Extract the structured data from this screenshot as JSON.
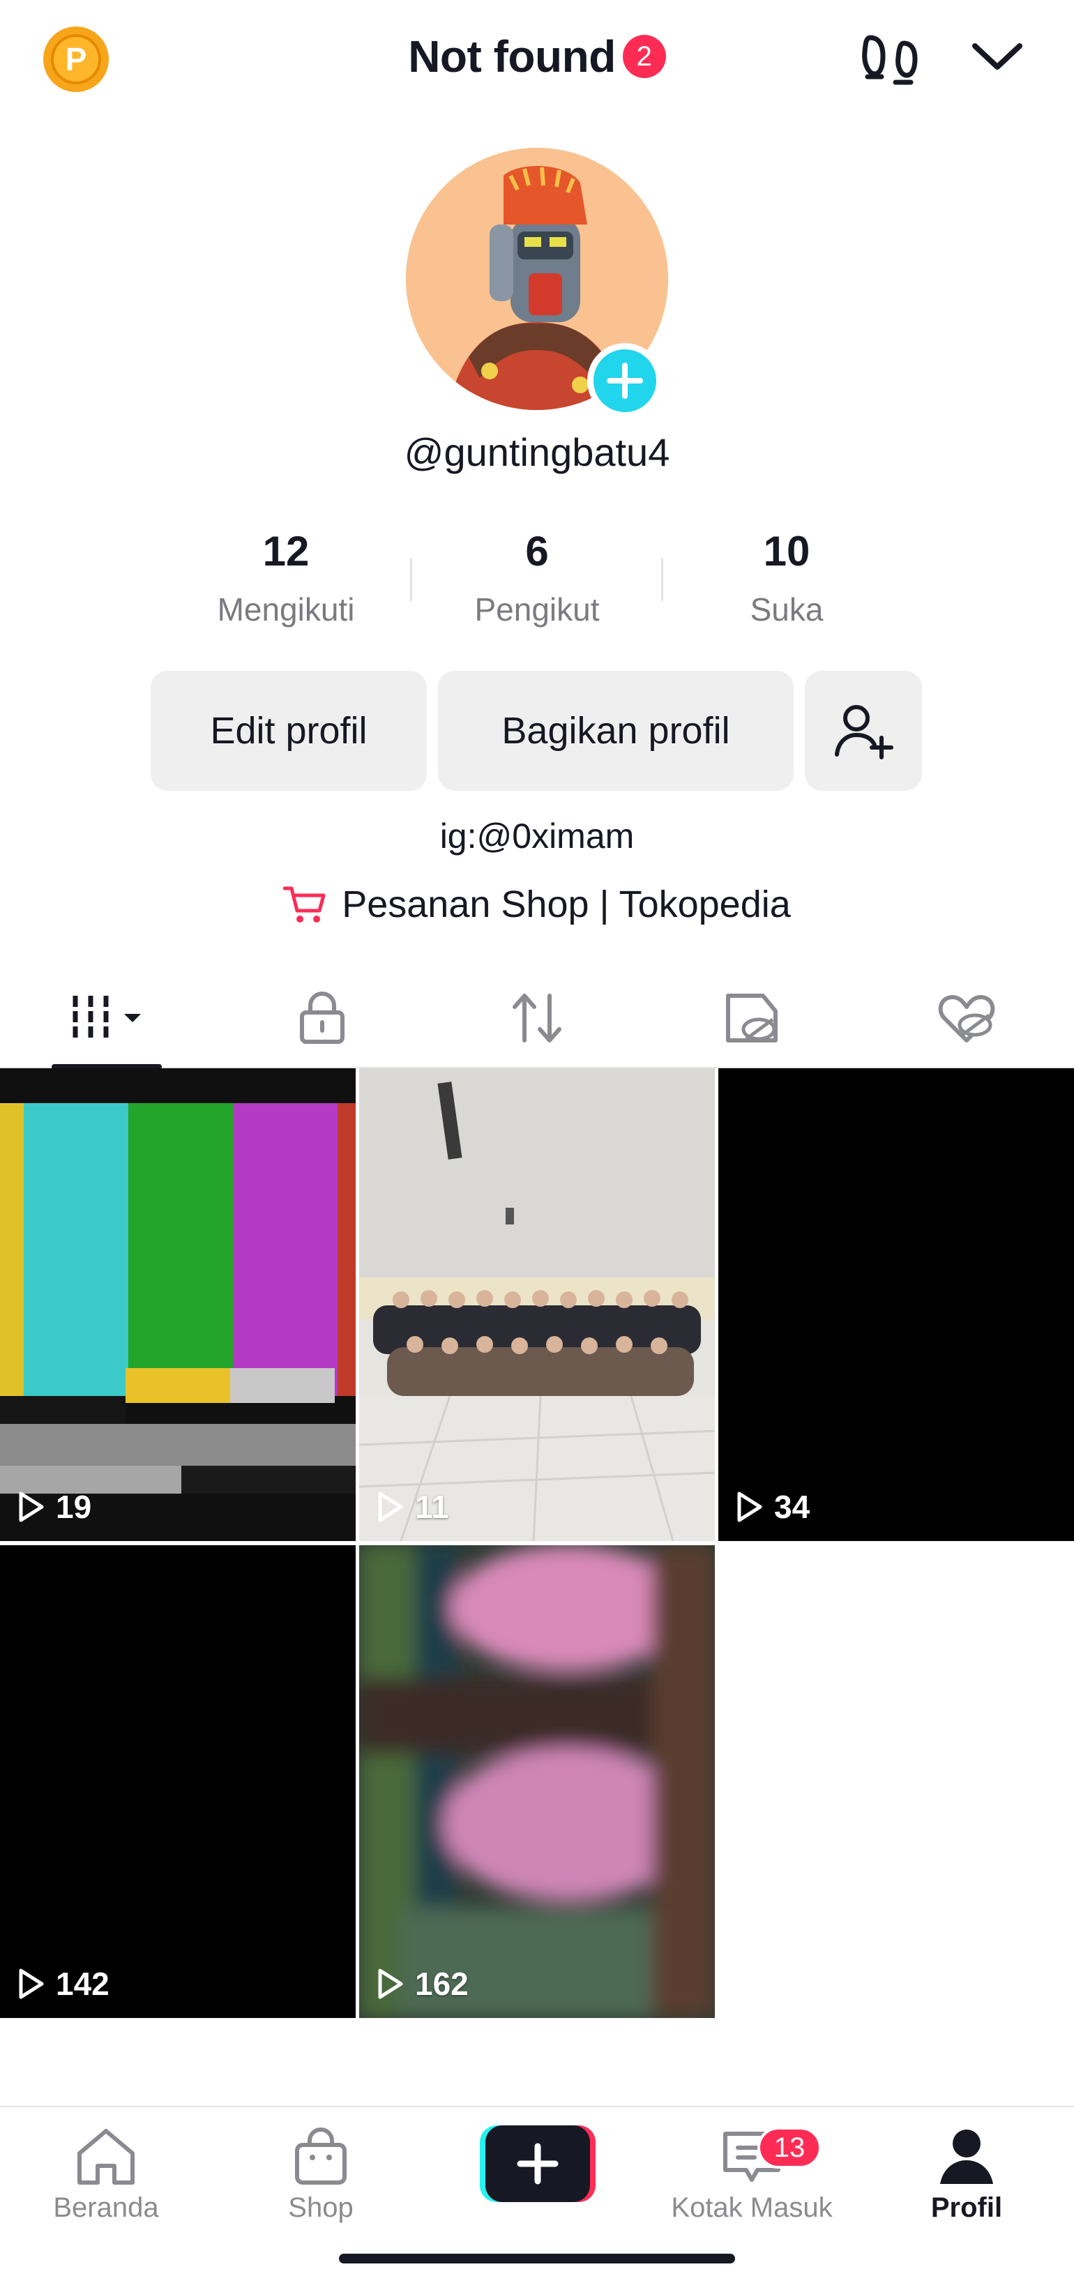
{
  "header": {
    "coin_letter": "P",
    "title": "Not found",
    "notification_count": "2"
  },
  "profile": {
    "username": "@guntingbatu4",
    "stats": [
      {
        "value": "12",
        "label": "Mengikuti"
      },
      {
        "value": "6",
        "label": "Pengikut"
      },
      {
        "value": "10",
        "label": "Suka"
      }
    ],
    "edit_label": "Edit profil",
    "share_label": "Bagikan profil",
    "bio": "ig:@0ximam",
    "shop_link": "Pesanan Shop | Tokopedia"
  },
  "tabs": [
    {
      "icon": "grid-icon",
      "active": true
    },
    {
      "icon": "lock-icon",
      "active": false
    },
    {
      "icon": "repost-icon",
      "active": false
    },
    {
      "icon": "favorites-hidden-icon",
      "active": false
    },
    {
      "icon": "liked-hidden-icon",
      "active": false
    }
  ],
  "videos": [
    {
      "views": "19",
      "thumb": "color-bars"
    },
    {
      "views": "11",
      "thumb": "group-photo"
    },
    {
      "views": "34",
      "thumb": "black"
    },
    {
      "views": "142",
      "thumb": "black"
    },
    {
      "views": "162",
      "thumb": "blurred-pink"
    }
  ],
  "bottom_nav": {
    "home": "Beranda",
    "shop": "Shop",
    "inbox": "Kotak Masuk",
    "inbox_badge": "13",
    "profile": "Profil"
  },
  "colors": {
    "accent_red": "#fe2c55",
    "accent_cyan": "#20d5ec",
    "coin": "#f7a51a"
  }
}
